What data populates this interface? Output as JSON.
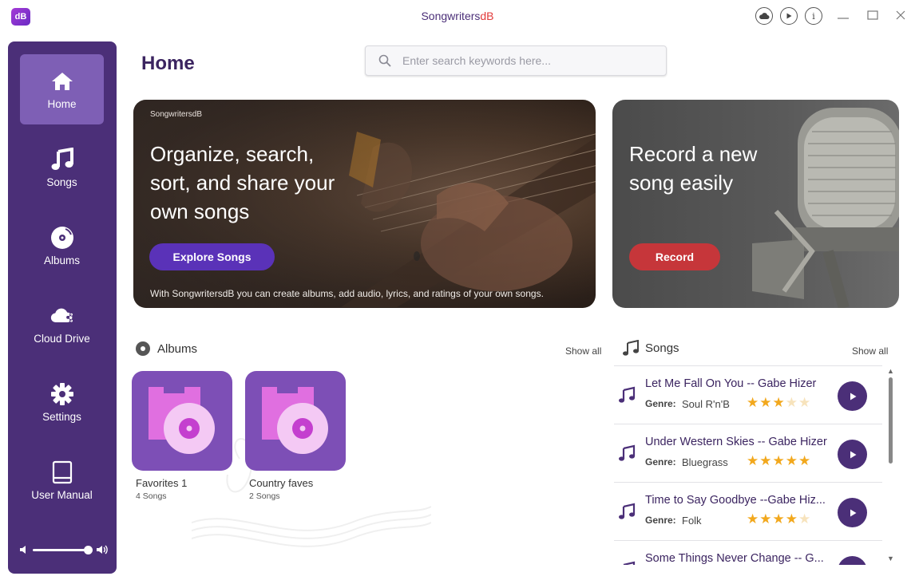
{
  "window": {
    "title_main": "Songwriters",
    "title_accent": "dB",
    "logo_text": "dB",
    "cloud_icon": "cloud-icon",
    "play_icon": "play-circle-icon",
    "info_icon": "info-icon"
  },
  "sidebar": {
    "items": [
      {
        "label": "Home",
        "icon": "home-icon"
      },
      {
        "label": "Songs",
        "icon": "music-note-icon"
      },
      {
        "label": "Albums",
        "icon": "album-disc-icon"
      },
      {
        "label": "Cloud Drive",
        "icon": "cloud-share-icon"
      },
      {
        "label": "Settings",
        "icon": "gear-icon"
      },
      {
        "label": "User Manual",
        "icon": "book-icon"
      }
    ],
    "volume_level": 0.85
  },
  "page_title": "Home",
  "search": {
    "placeholder": "Enter search keywords here..."
  },
  "banner_left": {
    "brand": "SongwritersdB",
    "headline": "Organize, search, sort, and share your own songs",
    "button": "Explore Songs",
    "footer": "With SongwritersdB you can create albums, add audio, lyrics, and ratings of your own songs."
  },
  "banner_right": {
    "headline": "Record a new song easily",
    "button": "Record"
  },
  "albums": {
    "heading": "Albums",
    "show_all": "Show all",
    "items": [
      {
        "name": "Favorites 1",
        "count": "4 Songs"
      },
      {
        "name": "Country faves",
        "count": "2 Songs"
      }
    ]
  },
  "songs": {
    "heading": "Songs",
    "show_all": "Show all",
    "genre_label": "Genre:",
    "items": [
      {
        "title": "Let Me Fall On You -- Gabe Hizer",
        "genre": "Soul R'n'B",
        "rating": 3
      },
      {
        "title": "Under Western Skies -- Gabe Hizer",
        "genre": "Bluegrass",
        "rating": 5
      },
      {
        "title": "Time to Say Goodbye --Gabe Hiz...",
        "genre": "Folk",
        "rating": 4
      },
      {
        "title": "Some Things Never Change -- G...",
        "genre": "",
        "rating": 0
      }
    ]
  },
  "colors": {
    "sidebar": "#4b2f78",
    "accent": "#5a32b8",
    "record": "#c6363a",
    "star": "#f2a81d"
  }
}
